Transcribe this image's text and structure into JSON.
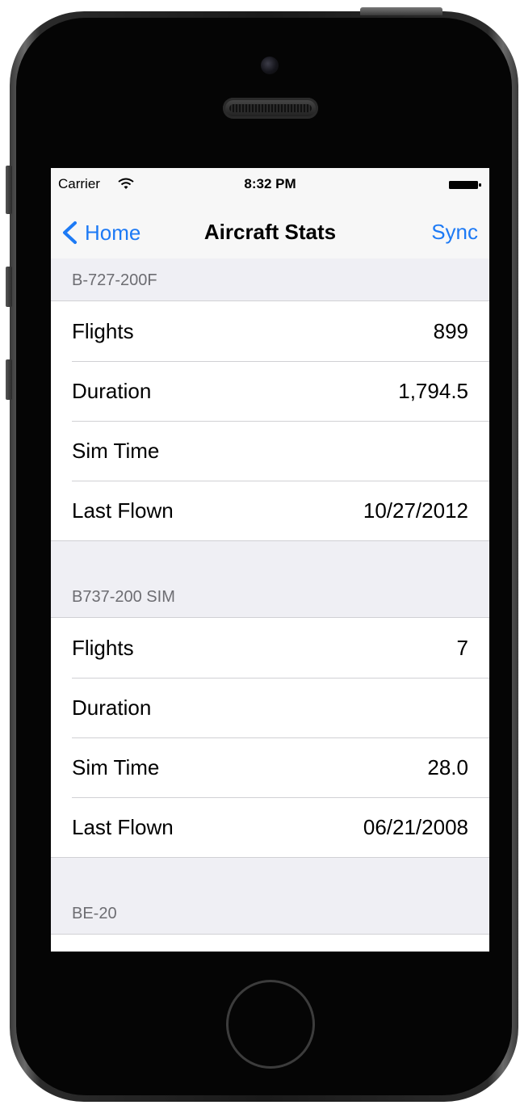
{
  "status_bar": {
    "carrier": "Carrier",
    "time": "8:32 PM"
  },
  "nav": {
    "back_label": "Home",
    "title": "Aircraft Stats",
    "right_button": "Sync"
  },
  "sections": [
    {
      "header": "B-727-200F",
      "rows": [
        {
          "label": "Flights",
          "value": "899"
        },
        {
          "label": "Duration",
          "value": "1,794.5"
        },
        {
          "label": "Sim Time",
          "value": ""
        },
        {
          "label": "Last Flown",
          "value": "10/27/2012"
        }
      ]
    },
    {
      "header": "B737-200 SIM",
      "rows": [
        {
          "label": "Flights",
          "value": "7"
        },
        {
          "label": "Duration",
          "value": ""
        },
        {
          "label": "Sim Time",
          "value": "28.0"
        },
        {
          "label": "Last Flown",
          "value": "06/21/2008"
        }
      ]
    },
    {
      "header": "BE-20",
      "rows": []
    }
  ],
  "colors": {
    "tint": "#1d7af5",
    "grouped_background": "#efeff4",
    "bar_background": "#f7f7f7"
  }
}
